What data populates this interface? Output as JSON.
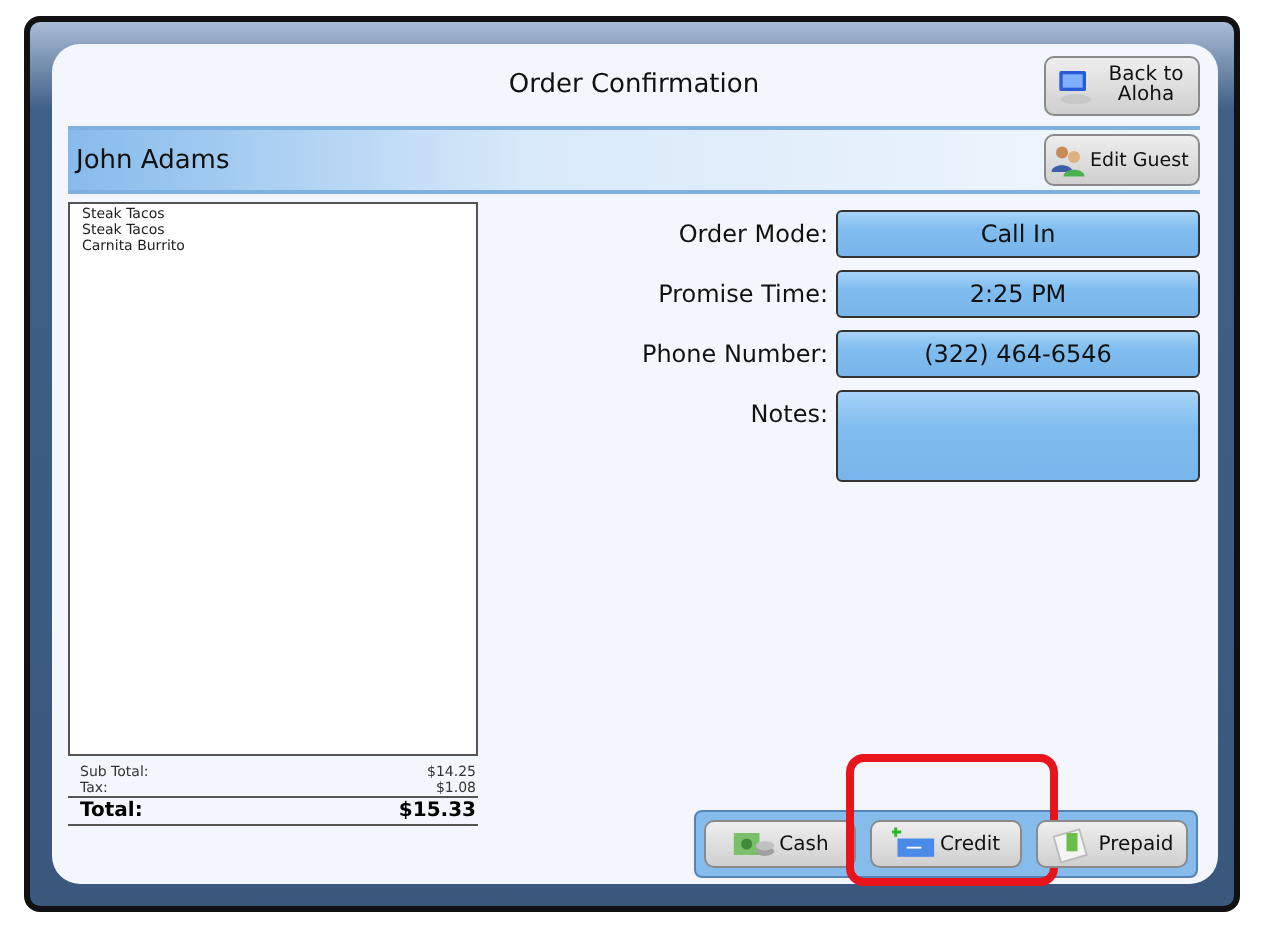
{
  "window": {
    "title": "Order Confirmation"
  },
  "back_button": {
    "label": "Back to Aloha"
  },
  "guest": {
    "name": "John Adams",
    "edit_button": "Edit Guest"
  },
  "order_items": [
    "Steak Tacos",
    "Steak Tacos",
    "Carnita Burrito"
  ],
  "totals": [
    {
      "kind": "minor",
      "label": "Sub Total:",
      "value": "$14.25"
    },
    {
      "kind": "minor",
      "label": "Tax:",
      "value": "$1.08"
    },
    {
      "kind": "grand",
      "label": "Total:",
      "value": "$15.33"
    }
  ],
  "fields": [
    {
      "kind": "single",
      "label": "Order Mode:",
      "value": "Call In"
    },
    {
      "kind": "single",
      "label": "Promise Time:",
      "value": "2:25 PM"
    },
    {
      "kind": "single",
      "label": "Phone Number:",
      "value": "(322) 464-6546"
    },
    {
      "kind": "multi",
      "label": "Notes:"
    }
  ],
  "payment_buttons": [
    {
      "kind": "cash",
      "label": "Cash",
      "highlighted": false
    },
    {
      "kind": "credit",
      "label": "Credit",
      "highlighted": true
    },
    {
      "kind": "prepaid",
      "label": "Prepaid",
      "highlighted": false
    }
  ]
}
